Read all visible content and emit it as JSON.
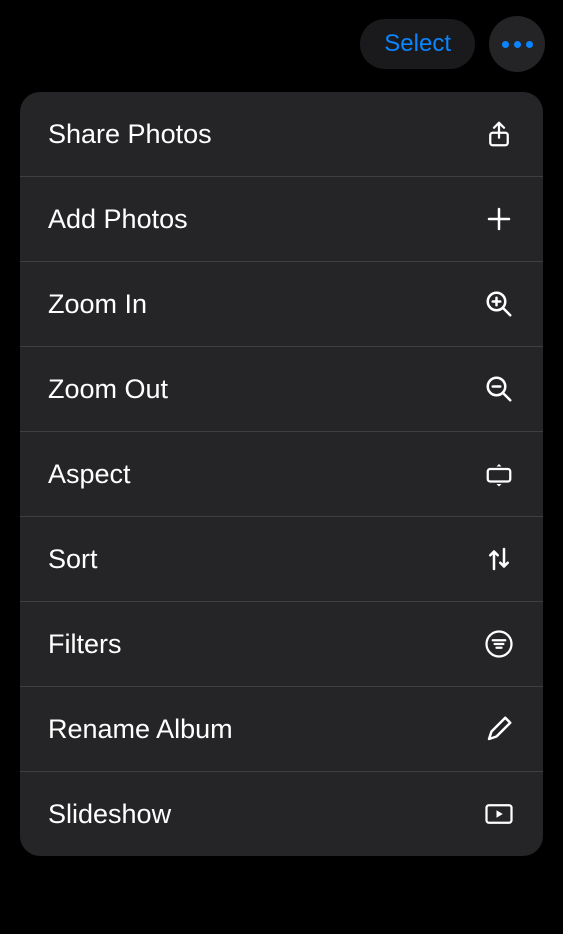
{
  "toolbar": {
    "select_label": "Select"
  },
  "menu": {
    "items": [
      {
        "label": "Share Photos",
        "icon": "share-icon"
      },
      {
        "label": "Add Photos",
        "icon": "plus-icon"
      },
      {
        "label": "Zoom In",
        "icon": "zoom-in-icon"
      },
      {
        "label": "Zoom Out",
        "icon": "zoom-out-icon"
      },
      {
        "label": "Aspect",
        "icon": "aspect-icon"
      },
      {
        "label": "Sort",
        "icon": "sort-icon"
      },
      {
        "label": "Filters",
        "icon": "filters-icon"
      },
      {
        "label": "Rename Album",
        "icon": "pencil-icon"
      },
      {
        "label": "Slideshow",
        "icon": "play-rect-icon"
      }
    ]
  },
  "colors": {
    "accent": "#0a84ff",
    "menu_bg": "#252527",
    "bg": "#000000"
  }
}
